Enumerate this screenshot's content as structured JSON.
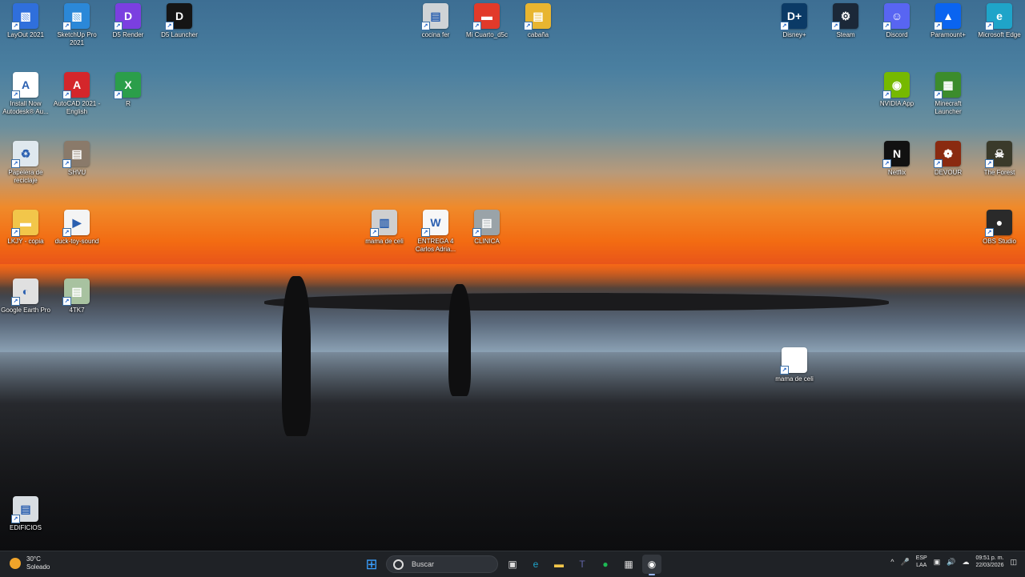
{
  "desktop_icons": [
    {
      "name": "layout-2021-icon",
      "label": "LayOut 2021",
      "color": "#2f6fdc",
      "glyph": "▧"
    },
    {
      "name": "sketchup-pro-2021-icon",
      "label": "SketchUp Pro 2021",
      "color": "#2b88d8",
      "glyph": "▧"
    },
    {
      "name": "d5-render-icon",
      "label": "D5 Render",
      "color": "#7b3fe0",
      "glyph": "D"
    },
    {
      "name": "d5-launcher-icon",
      "label": "D5 Launcher",
      "color": "#151515",
      "glyph": "D"
    },
    {
      "name": "cocina-fer-icon",
      "label": "cocina fer",
      "color": "#cfd3d6",
      "glyph": "▤"
    },
    {
      "name": "mi-cuarto-icon",
      "label": "Mi Cuarto_d5c",
      "color": "#e23a2a",
      "glyph": "▬"
    },
    {
      "name": "cabana-icon",
      "label": "cabaña",
      "color": "#e8b530",
      "glyph": "▤"
    },
    {
      "name": "disney-plus-icon",
      "label": "Disney+",
      "color": "#0b3a66",
      "glyph": "D+"
    },
    {
      "name": "steam-icon",
      "label": "Steam",
      "color": "#1b2838",
      "glyph": "⚙"
    },
    {
      "name": "discord-icon",
      "label": "Discord",
      "color": "#5865f2",
      "glyph": "☺"
    },
    {
      "name": "paramount-plus-icon",
      "label": "Paramount+",
      "color": "#0a64f0",
      "glyph": "▲"
    },
    {
      "name": "microsoft-edge-icon",
      "label": "Microsoft Edge",
      "color": "#1fa4c9",
      "glyph": "e"
    },
    {
      "name": "install-autodesk-icon",
      "label": "Install Now Autodesk® Au...",
      "color": "#ffffff",
      "glyph": "A"
    },
    {
      "name": "autocad-2021-icon",
      "label": "AutoCAD 2021 - English",
      "color": "#d4262b",
      "glyph": "A"
    },
    {
      "name": "r-file-icon",
      "label": "R",
      "color": "#2b9e4a",
      "glyph": "X"
    },
    {
      "name": "nvidia-app-icon",
      "label": "NVIDIA App",
      "color": "#76b900",
      "glyph": "◉"
    },
    {
      "name": "minecraft-launcher-icon",
      "label": "Minecraft Launcher",
      "color": "#3c8c2c",
      "glyph": "▦"
    },
    {
      "name": "recycle-bin-icon",
      "label": "Papelera de reciclaje",
      "color": "#dfe8ee",
      "glyph": "♻"
    },
    {
      "name": "shvu-icon",
      "label": "SHVU",
      "color": "#8a7a6a",
      "glyph": "▤"
    },
    {
      "name": "netflix-icon",
      "label": "Netflix",
      "color": "#111111",
      "glyph": "N"
    },
    {
      "name": "devour-icon",
      "label": "DEVOUR",
      "color": "#8a2a10",
      "glyph": "❁"
    },
    {
      "name": "the-forest-icon",
      "label": "The Forest",
      "color": "#3a3a2a",
      "glyph": "☠"
    },
    {
      "name": "lkjy-copia-icon",
      "label": "LKJY - copia",
      "color": "#f2c64a",
      "glyph": "▬"
    },
    {
      "name": "duck-toy-sound-icon",
      "label": "duck-toy-sound",
      "color": "#f4f4f4",
      "glyph": "▶"
    },
    {
      "name": "mama-de-celi-icon",
      "label": "mama de celi",
      "color": "#cfcfcf",
      "glyph": "▥"
    },
    {
      "name": "entrega-word-icon",
      "label": "ENTREGA 4 Carlos Adria...",
      "color": "#f7f7f7",
      "glyph": "W"
    },
    {
      "name": "clinica-icon",
      "label": "CLINICA",
      "color": "#9aa3a8",
      "glyph": "▤"
    },
    {
      "name": "obs-studio-icon",
      "label": "OBS Studio",
      "color": "#2a2a2a",
      "glyph": "●"
    },
    {
      "name": "google-earth-pro-icon",
      "label": "Google Earth Pro",
      "color": "#e0e0e0",
      "glyph": "◐"
    },
    {
      "name": "4tk7-icon",
      "label": "4TK7",
      "color": "#a8c2a0",
      "glyph": "▤"
    },
    {
      "name": "mama-de-celi-dragged-icon",
      "label": "mama de celi",
      "color": "#ffffff",
      "glyph": ""
    },
    {
      "name": "edificios-icon",
      "label": "EDIFICIOS",
      "color": "#d8dde2",
      "glyph": "▤"
    }
  ],
  "taskbar": {
    "weather_temp": "30°C",
    "weather_desc": "Soleado",
    "search_placeholder": "Buscar",
    "pinned": [
      {
        "name": "start-button",
        "glyph": "⊞",
        "color": "#3aa0ff"
      },
      {
        "name": "task-view-icon",
        "glyph": "▣",
        "color": "#dddddd"
      },
      {
        "name": "edge-taskbar-icon",
        "glyph": "e",
        "color": "#1fa4c9"
      },
      {
        "name": "file-explorer-icon",
        "glyph": "▬",
        "color": "#f2c64a"
      },
      {
        "name": "teams-icon",
        "glyph": "T",
        "color": "#6264a7"
      },
      {
        "name": "spotify-icon",
        "glyph": "●",
        "color": "#1db954"
      },
      {
        "name": "microsoft-store-icon",
        "glyph": "▦",
        "color": "#dddddd"
      },
      {
        "name": "obs-taskbar-icon",
        "glyph": "◉",
        "color": "#ffffff"
      }
    ],
    "tray": {
      "chevron": "^",
      "lang_top": "ESP",
      "lang_bottom": "LAA",
      "time": "09:51 p. m.",
      "date": "22/03/2026"
    }
  }
}
